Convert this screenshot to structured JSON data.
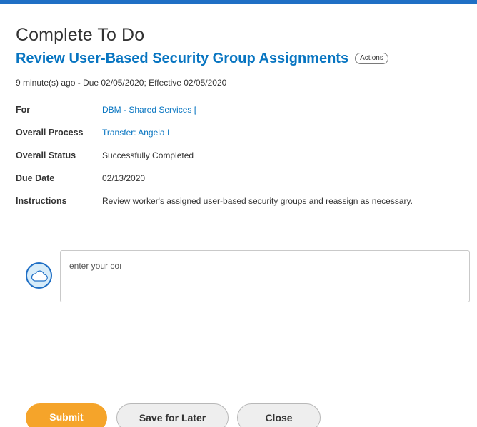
{
  "header": {
    "title": "Complete To Do",
    "subtitle": "Review User-Based Security Group Assignments",
    "actions_label": "Actions",
    "meta": "9 minute(s) ago - Due 02/05/2020; Effective 02/05/2020"
  },
  "details": {
    "for_label": "For",
    "for_value": "DBM - Shared Services [",
    "process_label": "Overall Process",
    "process_value": "Transfer: Angela I",
    "status_label": "Overall Status",
    "status_value": "Successfully Completed",
    "due_label": "Due Date",
    "due_value": "02/13/2020",
    "instructions_label": "Instructions",
    "instructions_value": "Review worker's assigned user-based security groups and reassign as necessary."
  },
  "comment": {
    "placeholder": "enter your coı"
  },
  "footer": {
    "submit_label": "Submit",
    "save_label": "Save for Later",
    "close_label": "Close"
  },
  "icons": {
    "avatar": "cloud-icon"
  },
  "colors": {
    "accent_blue": "#0875c1",
    "top_bar": "#1f6fc5",
    "submit_orange": "#f5a42a"
  }
}
